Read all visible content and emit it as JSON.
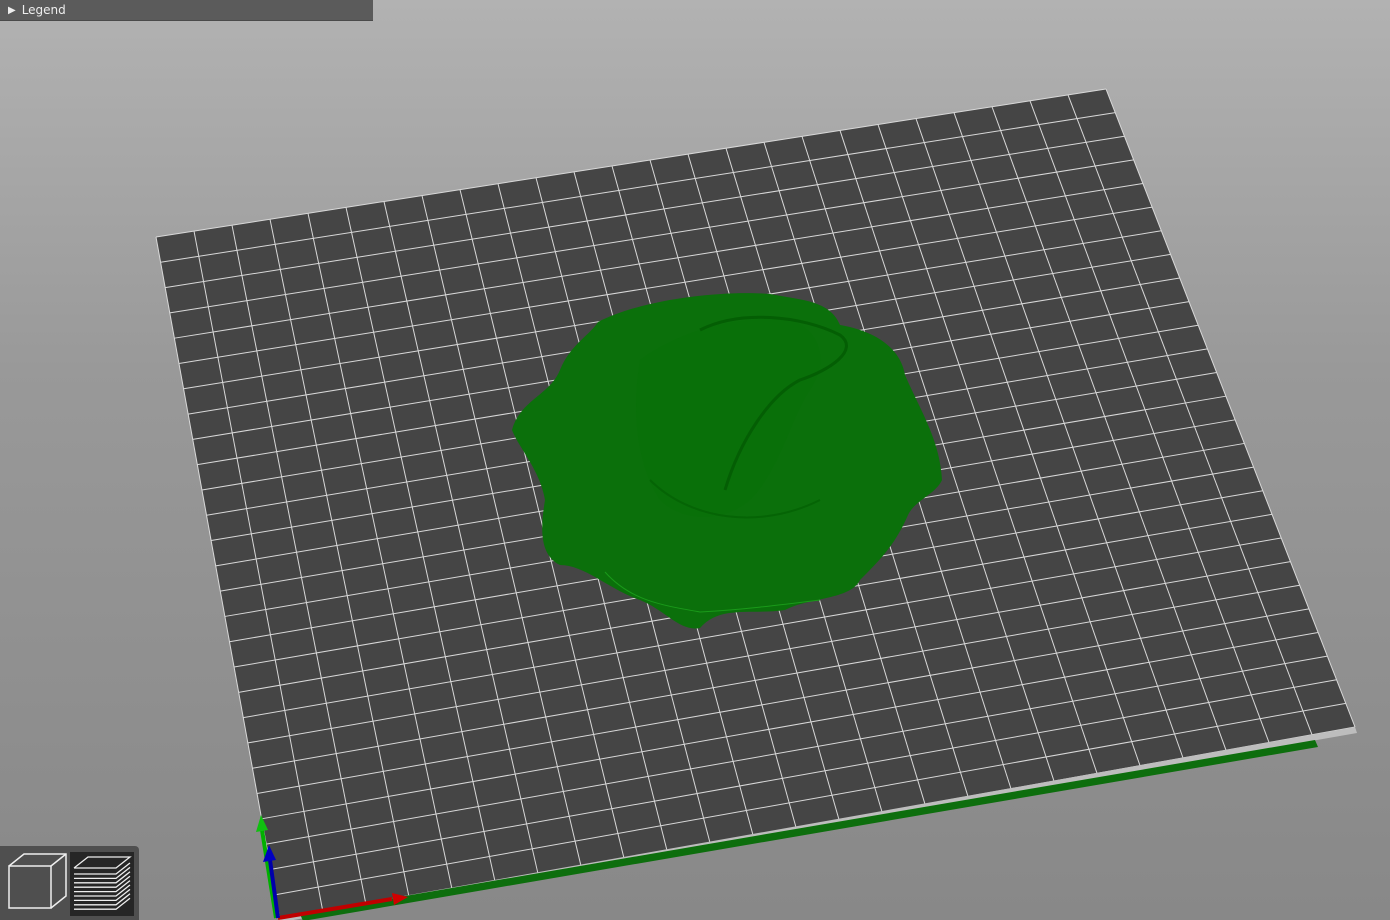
{
  "legend": {
    "label": "Legend",
    "expanded": false
  },
  "view_toolbar": {
    "buttons": [
      {
        "name": "3d-view",
        "active": false
      },
      {
        "name": "preview-layers",
        "active": true
      }
    ]
  },
  "colors": {
    "bed": "#454545",
    "grid": "#d8d8d8",
    "model": "#0d7a0d",
    "axis_x": "#c00000",
    "axis_y": "#00b000",
    "axis_z": "#0000aa"
  }
}
